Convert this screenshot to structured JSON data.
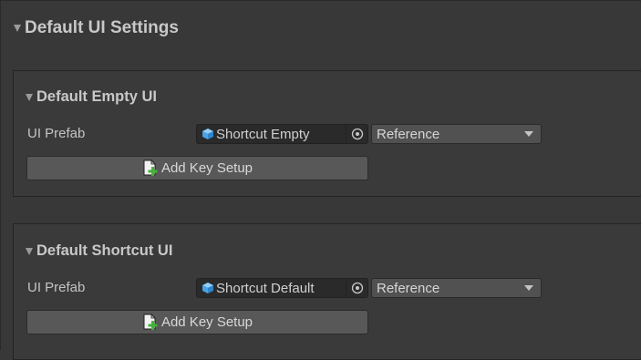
{
  "main_section": {
    "title": "Default UI Settings"
  },
  "panels": [
    {
      "title": "Default Empty UI",
      "field_label": "UI Prefab",
      "object_value": "Shortcut Empty",
      "enum_value": "Reference",
      "button_label": "Add Key Setup"
    },
    {
      "title": "Default Shortcut UI",
      "field_label": "UI Prefab",
      "object_value": "Shortcut Default",
      "enum_value": "Reference",
      "button_label": "Add Key Setup"
    }
  ],
  "icons": {
    "foldout": "triangle-down-icon",
    "prefab": "prefab-cube-icon",
    "picker": "object-picker-icon",
    "dropdown": "chevron-down-icon",
    "add": "add-document-icon"
  },
  "colors": {
    "background": "#383838",
    "panel": "#3a3a3a",
    "button": "#585858",
    "prefab_cube": "#5fb3f0",
    "add_plus": "#3fb534"
  }
}
